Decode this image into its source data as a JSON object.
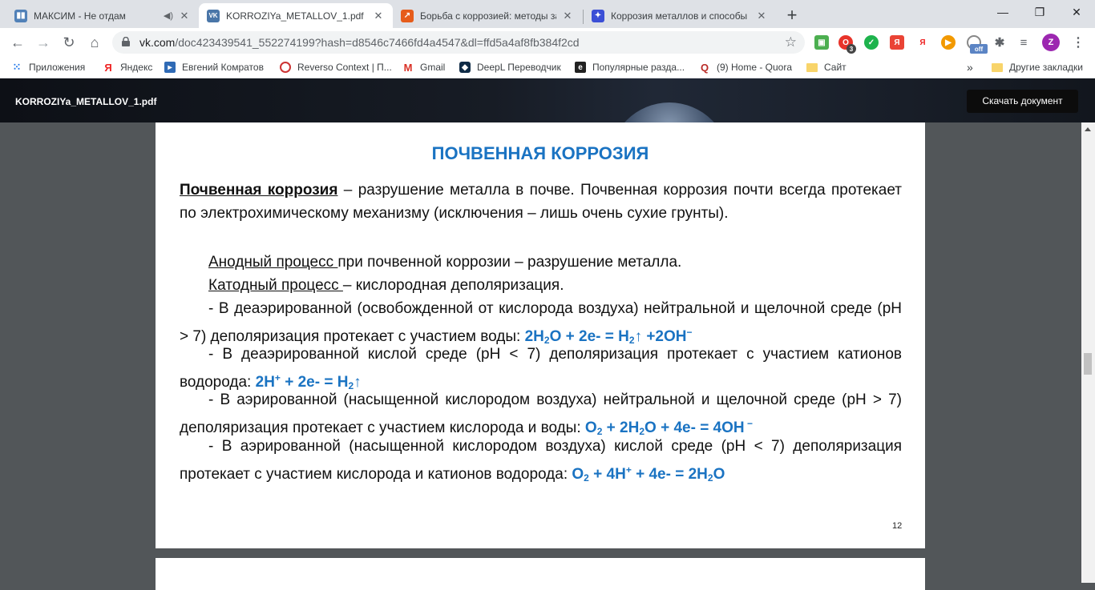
{
  "tabs": [
    {
      "title": "МАКСИМ - Не отдам",
      "fav_color": "#5181b8",
      "fav_glyph": "▮▮"
    },
    {
      "title": "KORROZIYa_METALLOV_1.pdf",
      "fav_color": "#4a76a8",
      "fav_glyph": "VK"
    },
    {
      "title": "Борьба с коррозией: методы за",
      "fav_color": "#e65c1a",
      "fav_glyph": "↗"
    },
    {
      "title": "Коррозия металлов и способы",
      "fav_color": "#3b4fd6",
      "fav_glyph": "✦"
    }
  ],
  "address": {
    "host": "vk.com",
    "path": "/doc423439541_552274199?hash=d8546c7466fd4a4547&dl=ffd5a4af8fb384f2cd"
  },
  "extensions": {
    "badge_count": "3",
    "off_label": "off",
    "profile_letter": "Z"
  },
  "bookmarks": [
    {
      "label": "Приложения",
      "icon": "apps-grid-icon"
    },
    {
      "label": "Яндекс",
      "icon": "yandex-icon"
    },
    {
      "label": "Евгений Комратов",
      "icon": "bookmark-page-icon"
    },
    {
      "label": "Reverso Context | П...",
      "icon": "reverso-icon"
    },
    {
      "label": "Gmail",
      "icon": "gmail-icon"
    },
    {
      "label": "DeepL Переводчик",
      "icon": "deepl-icon"
    },
    {
      "label": "Популярные разда...",
      "icon": "popular-icon"
    },
    {
      "label": "(9) Home - Quora",
      "icon": "quora-icon"
    },
    {
      "label": "Сайт",
      "icon": "folder-icon"
    }
  ],
  "bookmarks_more": "»",
  "other_bookmarks": "Другие закладки",
  "viewer": {
    "doc_title": "KORROZIYa_METALLOV_1.pdf",
    "download_label": "Скачать документ"
  },
  "document": {
    "title": "ПОЧВЕННАЯ КОРРОЗИЯ",
    "def_term": "Почвенная коррозия",
    "def_text": " – разрушение металла в почве. Почвенная коррозия почти всегда протекает по электрохимическому механизму (исключения – лишь очень сухие грунты).",
    "anodic_term": "Анодный процесс ",
    "anodic_text": "при почвенной коррозии – разрушение металла.",
    "cathodic_term": "Катодный процесс ",
    "cathodic_text": "– кислородная деполяризация.",
    "case1_text": "- В деаэрированной (освобожденной от кислорода воздуха) нейтральной и щелочной среде (pH > 7) деполяризация протекает с участием воды: ",
    "case2_text": "- В деаэрированной кислой среде (pH < 7) деполяризация протекает с участием катионов водорода: ",
    "case3_text": " - В аэрированной (насыщенной кислородом воздуха) нейтральной и щелочной среде (pH > 7) деполяризация протекает с участием кислорода и воды: ",
    "case4_text": " - В аэрированной (насыщенной кислородом воздуха) кислой среде (pH < 7) деполяризация протекает с участием кислорода и катионов водорода: ",
    "page_number": "12"
  },
  "colors": {
    "accent_blue": "#1a73c2",
    "page_bg": "#525659",
    "viewer_header": "#12161d"
  }
}
